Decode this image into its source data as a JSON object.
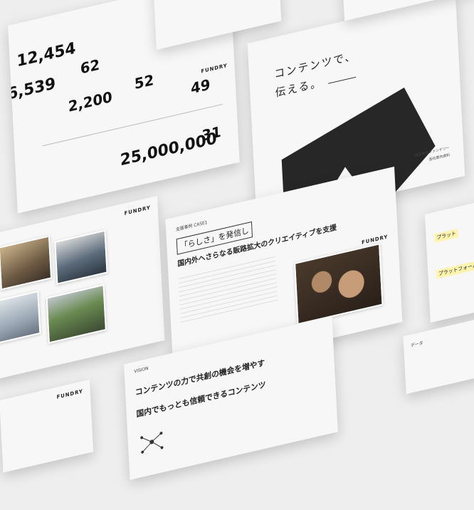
{
  "stats_slide": {
    "stats": [
      {
        "value": "12,454"
      },
      {
        "value": "6,539"
      },
      {
        "value": "62"
      },
      {
        "value": "2,200"
      },
      {
        "value": "52"
      },
      {
        "value": "49"
      },
      {
        "value": "25,000,000"
      },
      {
        "value": "31"
      }
    ],
    "brand": "FUNDRY"
  },
  "hero_slide": {
    "title_line1": "コンテンツで、",
    "title_line2": "伝える。",
    "caption_right": "株式会社ファンドリー",
    "caption_right2": "会社案内資料"
  },
  "photos_slide": {
    "brand": "FUNDRY"
  },
  "case_slide": {
    "label": "支援事例 CASE1",
    "heading1": "「らしさ」を発信し",
    "heading2": "国内外へさらなる販路拡大のクリエイティブを支援",
    "brand": "FUNDRY"
  },
  "vision_slide": {
    "label": "VISION",
    "heading1": "コンテンツの力で共創の機会を増やす",
    "heading2": "国内でもっとも信頼できるコンテンツ"
  },
  "platform_slide": {
    "label1": "プラット",
    "label2": "プラットフォーム"
  },
  "data_slide": {
    "label": "データ"
  },
  "small_slide": {
    "brand": "FUNDRY"
  },
  "colors": {
    "background": "#eeeeee",
    "slide": "#f7f7f7",
    "ink": "#222222",
    "accent_yellow": "#f2c400"
  }
}
